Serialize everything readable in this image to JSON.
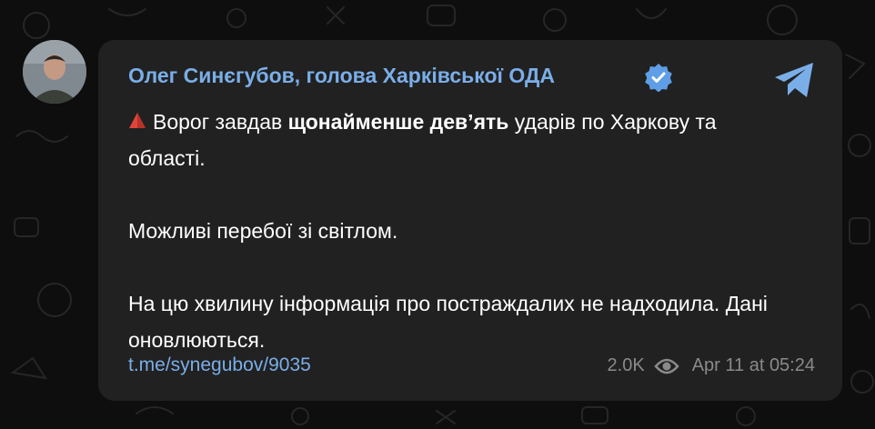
{
  "post": {
    "author": "Олег Синєгубов, голова Харківської ОДА",
    "intro": "Ворог завдав ",
    "emphasis": "щонайменше дев’ять",
    "intro_end": " ударів по Харкову та області.",
    "paragraph2": "Можливі перебої зі світлом.",
    "paragraph3": "На цю хвилину інформація про постраждалих не надходила. Дані оновлюються.",
    "link": "t.me/synegubov/9035",
    "views": "2.0K",
    "timestamp": "Apr 11 at 05:24"
  },
  "icons": {
    "verified": "verified-badge-icon",
    "share": "telegram-share-icon",
    "views": "eye-icon",
    "warning": "red-triangle-icon"
  },
  "colors": {
    "background": "#0e0e0e",
    "bubble": "#212121",
    "accent": "#7aaee8",
    "warning": "#e0453a",
    "meta": "#8a8a8a"
  }
}
